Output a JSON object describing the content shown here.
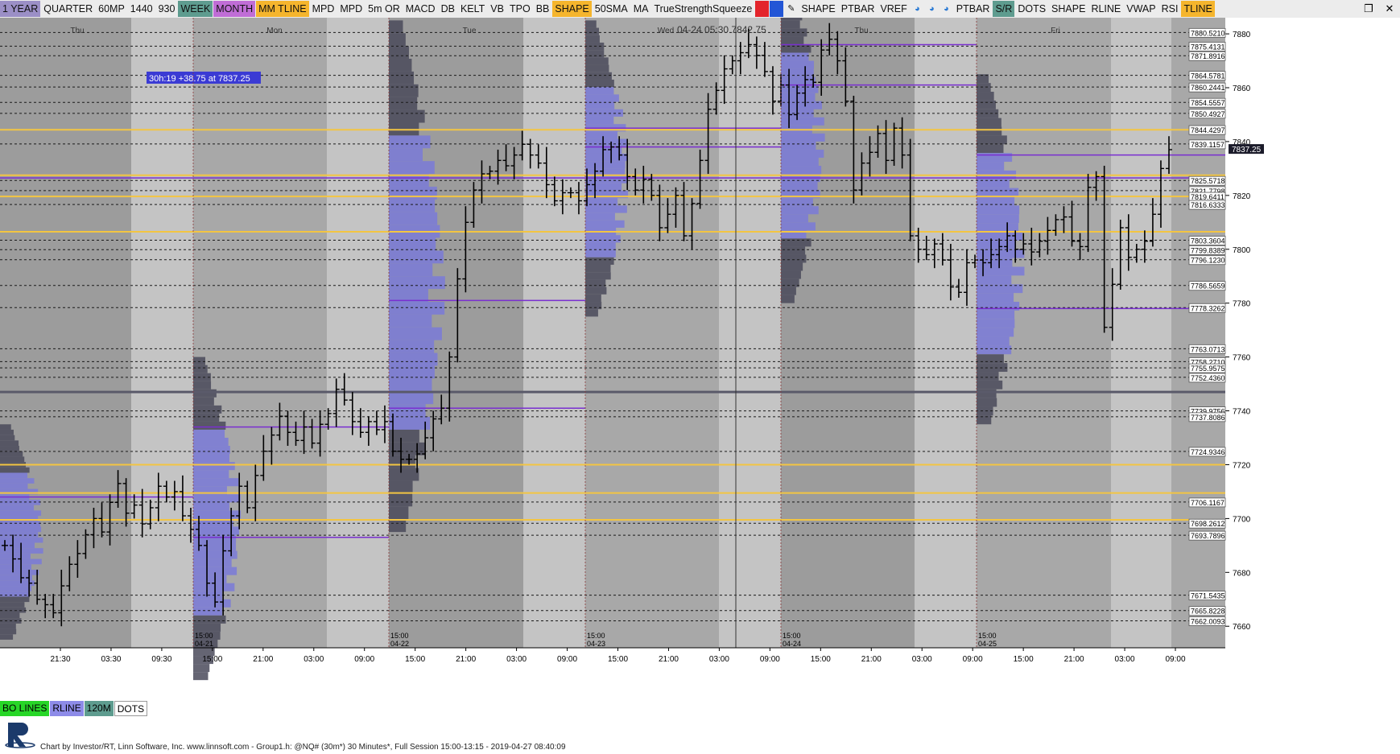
{
  "toolbar": {
    "buttons": [
      {
        "label": "1 YEAR",
        "bg": "#9b8fc6"
      },
      {
        "label": "QUARTER",
        "bg": ""
      },
      {
        "label": "60MP",
        "bg": ""
      },
      {
        "label": "1440",
        "bg": ""
      },
      {
        "label": "930",
        "bg": ""
      },
      {
        "label": "WEEK",
        "bg": "#5e9c8f"
      },
      {
        "label": "MONTH",
        "bg": "#c06dd6"
      },
      {
        "label": "MM TLINE",
        "bg": "#f5b52d"
      },
      {
        "label": "MPD",
        "bg": ""
      },
      {
        "label": "MPD",
        "bg": ""
      },
      {
        "label": "5m OR",
        "bg": ""
      },
      {
        "label": "MACD",
        "bg": ""
      },
      {
        "label": "DB",
        "bg": ""
      },
      {
        "label": "KELT",
        "bg": ""
      },
      {
        "label": "VB",
        "bg": ""
      },
      {
        "label": "TPO",
        "bg": ""
      },
      {
        "label": "BB",
        "bg": ""
      },
      {
        "label": "SHAPE",
        "bg": "#f5b52d"
      },
      {
        "label": "50SMA",
        "bg": ""
      },
      {
        "label": "MA",
        "bg": ""
      },
      {
        "label": "TrueStrengthSqueeze",
        "bg": ""
      },
      {
        "icon": "square-icon",
        "bg": "#e3242b"
      },
      {
        "icon": "square-icon",
        "bg": "#2356d6"
      },
      {
        "icon": "pencil-icon",
        "bg": ""
      },
      {
        "label": "SHAPE",
        "bg": ""
      },
      {
        "label": "PTBAR",
        "bg": ""
      },
      {
        "label": "VREF",
        "bg": ""
      },
      {
        "icon": "circle-arrow-icon",
        "bg": ""
      },
      {
        "icon": "circle-arrow-icon",
        "bg": ""
      },
      {
        "icon": "circle-arrow-icon",
        "bg": ""
      },
      {
        "label": "PTBAR",
        "bg": ""
      },
      {
        "label": "S/R",
        "bg": "#5e9c8f"
      },
      {
        "label": "DOTS",
        "bg": ""
      },
      {
        "label": "SHAPE",
        "bg": ""
      },
      {
        "label": "RLINE",
        "bg": ""
      },
      {
        "label": "VWAP",
        "bg": ""
      },
      {
        "label": "RSI",
        "bg": ""
      },
      {
        "label": "TLINE",
        "bg": "#f5b52d"
      }
    ],
    "window_icons": [
      "restore-icon",
      "close-icon"
    ]
  },
  "bottom_tags": [
    {
      "label": "BO LINES",
      "bg": "#27d627"
    },
    {
      "label": "RLINE",
      "bg": "#8d8be8"
    },
    {
      "label": "120M",
      "bg": "#5e9c8f"
    },
    {
      "label": "DOTS",
      "bg": "#ffffff"
    }
  ],
  "info_box": "30h:19  +38.75 at 7837.25",
  "crosshair": {
    "date": "04-24",
    "time": "05:30",
    "price": "7842.75"
  },
  "footer": "Chart by Investor/RT, Linn Software, Inc. www.linnsoft.com - Group1.h: @NQ# (30m*) 30 Minutes*, Full Session 15:00-13:15 - 2019-04-27 08:40:09",
  "last_price": "7837.25",
  "chart_data": {
    "type": "candlestick",
    "instrument": "@NQ#",
    "y_axis": {
      "min": 7652,
      "max": 7886,
      "ticks": [
        7660,
        7680,
        7700,
        7720,
        7740,
        7760,
        7780,
        7800,
        7820,
        7840,
        7860,
        7880
      ]
    },
    "day_labels": [
      {
        "label": "Thu",
        "x_index": 1
      },
      {
        "label": "Mon",
        "x_index": 2
      },
      {
        "label": "Tue",
        "x_index": 3
      },
      {
        "label": "Wed",
        "x_index": 4
      },
      {
        "label": "Thu",
        "x_index": 5
      },
      {
        "label": "Fri",
        "x_index": 6
      }
    ],
    "session_labels": [
      {
        "time": "15:00",
        "date": "04-21"
      },
      {
        "time": "15:00",
        "date": "04-22"
      },
      {
        "time": "15:00",
        "date": "04-23"
      },
      {
        "time": "15:00",
        "date": "04-24"
      },
      {
        "time": "15:00",
        "date": "04-25"
      }
    ],
    "time_labels": [
      "21:30",
      "03:30",
      "09:30",
      "15:00",
      "21:00",
      "03:00",
      "09:00",
      "15:00",
      "21:00",
      "03:00",
      "09:00",
      "15:00",
      "21:00",
      "03:00",
      "09:00",
      "15:00",
      "21:00",
      "03:00",
      "09:00",
      "15:00",
      "21:00",
      "03:00",
      "09:00"
    ],
    "price_levels": [
      "7880.5210",
      "7875.4131",
      "7871.8916",
      "7864.5781",
      "7860.2441",
      "7854.5557",
      "7850.4927",
      "7844.4297",
      "7839.1157",
      "7825.5718",
      "7821.7798",
      "7819.6411",
      "7816.6333",
      "7803.3604",
      "7799.8389",
      "7796.1230",
      "7786.5659",
      "7778.3262",
      "7763.0713",
      "7758.2710",
      "7755.9575",
      "7752.4360",
      "7739.9756",
      "7737.8086",
      "7724.9346",
      "7706.1167",
      "7698.2612",
      "7693.7896",
      "7671.5435",
      "7665.8228",
      "7662.0093"
    ],
    "yellow_lines": [
      7827.5,
      7819.6,
      7844.4,
      7806.5,
      7720.0,
      7699.5,
      7709.5
    ],
    "closes": [
      7690,
      7685,
      7678,
      7676,
      7670,
      7668,
      7665,
      7675,
      7683,
      7687,
      7694,
      7700,
      7695,
      7706,
      7713,
      7702,
      7705,
      7698,
      7704,
      7712,
      7708,
      7710,
      7701,
      7696,
      7690,
      7676,
      7669,
      7688,
      7701,
      7712,
      7704,
      7716,
      7725,
      7731,
      7738,
      7732,
      7729,
      7734,
      7728,
      7735,
      7739,
      7748,
      7744,
      7736,
      7732,
      7736,
      7733,
      7736,
      7725,
      7722,
      7722,
      7724,
      7730,
      7737,
      7741,
      7760,
      7789,
      7810,
      7822,
      7828,
      7829,
      7833,
      7831,
      7835,
      7839,
      7835,
      7832,
      7824,
      7818,
      7821,
      7821,
      7818,
      7824,
      7829,
      7837,
      7838,
      7835,
      7827,
      7822,
      7826,
      7820,
      7808,
      7813,
      7820,
      7805,
      7817,
      7833,
      7852,
      7859,
      7867,
      7870,
      7873,
      7876,
      7872,
      7866,
      7855,
      7861,
      7850,
      7858,
      7863,
      7862,
      7874,
      7878,
      7870,
      7855,
      7822,
      7832,
      7836,
      7843,
      7833,
      7845,
      7835,
      7805,
      7800,
      7798,
      7802,
      7796,
      7786,
      7784,
      7795,
      7796,
      7795,
      7798,
      7801,
      7805,
      7800,
      7802,
      7799,
      7803,
      7807,
      7811,
      7812,
      7803,
      7801,
      7823,
      7827,
      7771,
      7787,
      7808,
      7797,
      7800,
      7803,
      7813,
      7830,
      7837
    ]
  }
}
